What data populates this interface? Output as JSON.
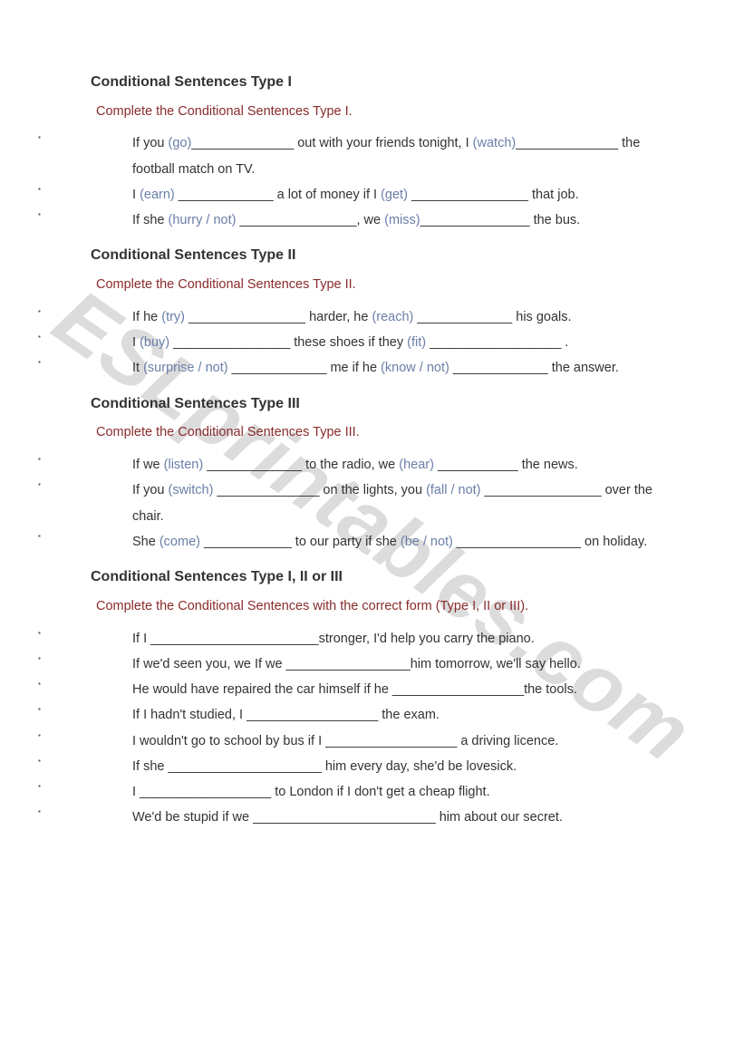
{
  "watermark": "ESLprintables.com",
  "sections": [
    {
      "heading": "Conditional Sentences Type I",
      "instruction": "Complete the Conditional Sentences Type I.",
      "items": [
        {
          "parts": [
            {
              "t": "If you "
            },
            {
              "h": "(go)"
            },
            {
              "t": "______________ out with your friends tonight, I "
            },
            {
              "h": "(watch)"
            },
            {
              "t": "______________ the football match on TV."
            }
          ]
        },
        {
          "parts": [
            {
              "t": "I "
            },
            {
              "h": "(earn)"
            },
            {
              "t": " _____________ a lot of money if I "
            },
            {
              "h": "(get)"
            },
            {
              "t": " ________________ that job."
            }
          ]
        },
        {
          "parts": [
            {
              "t": "If she "
            },
            {
              "h": "(hurry / not)"
            },
            {
              "t": " ________________, we "
            },
            {
              "h": "(miss)"
            },
            {
              "t": "_______________ the bus."
            }
          ]
        }
      ]
    },
    {
      "heading": "Conditional Sentences Type II",
      "instruction": "Complete the Conditional Sentences Type II.",
      "items": [
        {
          "parts": [
            {
              "t": "If he "
            },
            {
              "h": "(try)"
            },
            {
              "t": " ________________ harder, he "
            },
            {
              "h": "(reach)"
            },
            {
              "t": " _____________ his goals."
            }
          ]
        },
        {
          "parts": [
            {
              "t": "I "
            },
            {
              "h": "(buy)"
            },
            {
              "t": " ________________ these shoes if they "
            },
            {
              "h": "(fit)"
            },
            {
              "t": " __________________ ."
            }
          ]
        },
        {
          "parts": [
            {
              "t": "It "
            },
            {
              "h": "(surprise / not)"
            },
            {
              "t": " _____________ me if he "
            },
            {
              "h": "(know / not)"
            },
            {
              "t": " _____________ the answer."
            }
          ]
        }
      ]
    },
    {
      "heading": "Conditional Sentences Type III",
      "instruction": "Complete the Conditional Sentences Type III.",
      "items": [
        {
          "parts": [
            {
              "t": "If we "
            },
            {
              "h": "(listen)"
            },
            {
              "t": " _____________ to the radio, we "
            },
            {
              "h": "(hear)"
            },
            {
              "t": " ___________ the news."
            }
          ]
        },
        {
          "parts": [
            {
              "t": "If you "
            },
            {
              "h": "(switch)"
            },
            {
              "t": " ______________ on the lights, you "
            },
            {
              "h": "(fall / not)"
            },
            {
              "t": " ________________ over the chair."
            }
          ]
        },
        {
          "parts": [
            {
              "t": "She "
            },
            {
              "h": "(come)"
            },
            {
              "t": " ____________ to our party if she "
            },
            {
              "h": "(be / not)"
            },
            {
              "t": " _________________ on holiday."
            }
          ]
        }
      ]
    },
    {
      "heading": "Conditional Sentences Type I, II or III",
      "instruction": "Complete the Conditional Sentences with the correct form (Type I, II or III).",
      "items": [
        {
          "parts": [
            {
              "t": "If I _______________________stronger, I'd help you carry the piano."
            }
          ]
        },
        {
          "parts": [
            {
              "t": "If we'd seen you, we If we _________________him tomorrow, we'll say hello."
            }
          ]
        },
        {
          "parts": [
            {
              "t": "He would have repaired the car himself if he  __________________the tools."
            }
          ]
        },
        {
          "parts": [
            {
              "t": "If I hadn't studied, I __________________ the exam."
            }
          ]
        },
        {
          "parts": [
            {
              "t": "I wouldn't go to school by bus if I __________________ a driving licence."
            }
          ]
        },
        {
          "parts": [
            {
              "t": "If she _____________________ him every day, she'd be lovesick."
            }
          ]
        },
        {
          "parts": [
            {
              "t": "I __________________ to London if I don't get a cheap flight."
            }
          ]
        },
        {
          "parts": [
            {
              "t": "We'd be stupid if we _________________________ him about our secret."
            }
          ]
        }
      ]
    }
  ]
}
